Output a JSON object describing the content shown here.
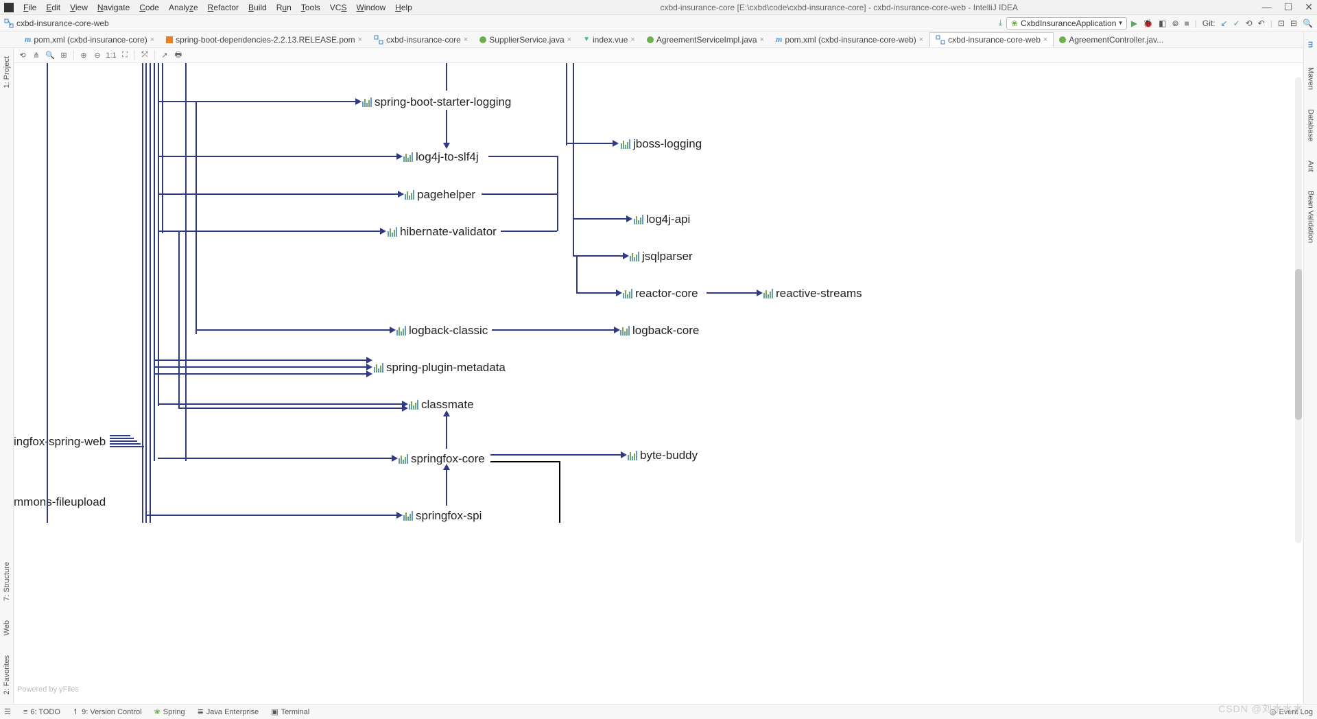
{
  "window": {
    "title": "cxbd-insurance-core [E:\\cxbd\\code\\cxbd-insurance-core] - cxbd-insurance-core-web - IntelliJ IDEA"
  },
  "menu": {
    "file": "File",
    "edit": "Edit",
    "view": "View",
    "navigate": "Navigate",
    "code": "Code",
    "analyze": "Analyze",
    "refactor": "Refactor",
    "build": "Build",
    "run": "Run",
    "tools": "Tools",
    "vcs": "VCS",
    "window": "Window",
    "help": "Help"
  },
  "breadcrumb": {
    "item": "cxbd-insurance-core-web"
  },
  "runconfig": {
    "name": "CxbdInsuranceApplication"
  },
  "git_label": "Git:",
  "tabs": [
    {
      "label": "pom.xml (cxbd-insurance-core)",
      "icon": "m"
    },
    {
      "label": "spring-boot-dependencies-2.2.13.RELEASE.pom",
      "icon": "pom"
    },
    {
      "label": "cxbd-insurance-core",
      "icon": "diag"
    },
    {
      "label": "SupplierService.java",
      "icon": "java"
    },
    {
      "label": "index.vue",
      "icon": "vue"
    },
    {
      "label": "AgreementServiceImpl.java",
      "icon": "java"
    },
    {
      "label": "pom.xml (cxbd-insurance-core-web)",
      "icon": "m"
    },
    {
      "label": "cxbd-insurance-core-web",
      "icon": "diag",
      "active": true
    },
    {
      "label": "AgreementController.jav...",
      "icon": "java"
    }
  ],
  "toolbar_1_1": "1:1",
  "left_tools": {
    "project": "1: Project",
    "structure": "7: Structure",
    "web": "Web",
    "favorites": "2: Favorites"
  },
  "right_tools": {
    "maven": "Maven",
    "database": "Database",
    "ant": "Ant",
    "bean": "Bean Validation"
  },
  "bottom": {
    "todo": "6: TODO",
    "vcs": "9: Version Control",
    "spring": "Spring",
    "jee": "Java Enterprise",
    "terminal": "Terminal",
    "eventlog": "Event Log"
  },
  "nodes": {
    "n1": "spring-boot-starter-logging",
    "n2": "log4j-to-slf4j",
    "n3": "pagehelper",
    "n4": "hibernate-validator",
    "n5": "logback-classic",
    "n6": "spring-plugin-metadata",
    "n7": "classmate",
    "n8": "springfox-core",
    "n9": "springfox-spi",
    "n10": "ingfox-spring-web",
    "n11": "mmons-fileupload",
    "n12": "jboss-logging",
    "n13": "log4j-api",
    "n14": "jsqlparser",
    "n15": "reactor-core",
    "n16": "logback-core",
    "n17": "byte-buddy",
    "n18": "reactive-streams"
  },
  "watermark_yfiles": "Powered by yFiles",
  "watermark_csdn": "CSDN @刘水水水"
}
